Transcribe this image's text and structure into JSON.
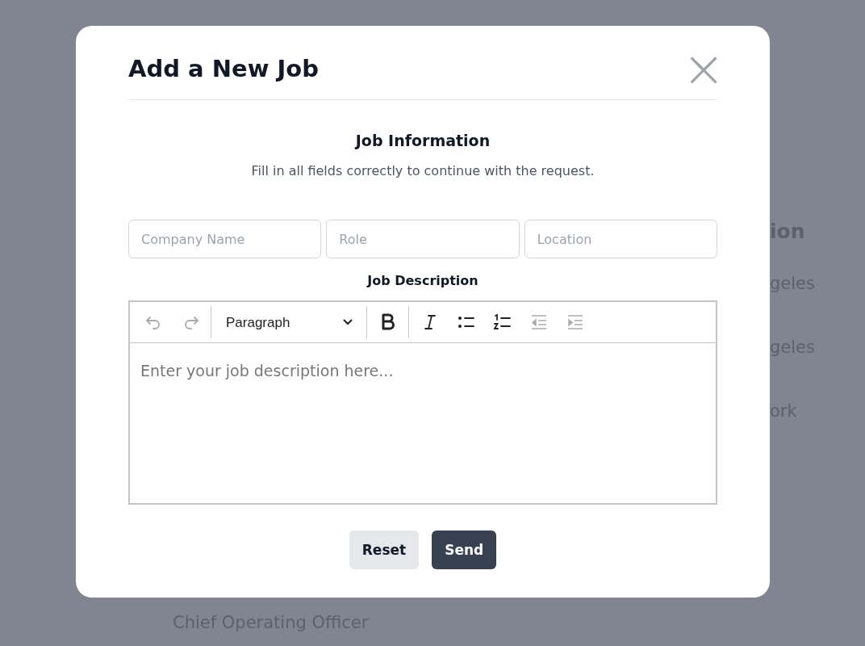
{
  "background": {
    "texts": [
      {
        "text": "ion",
        "kind": "heading"
      },
      {
        "text": "geles",
        "kind": "cell"
      },
      {
        "text": "geles",
        "kind": "cell"
      },
      {
        "text": "ork",
        "kind": "cell"
      }
    ],
    "footer_text": "Chief Operating Officer"
  },
  "modal": {
    "title": "Add a New Job",
    "close": "×",
    "section_title": "Job Information",
    "subtitle": "Fill in all fields correctly to continue with the request.",
    "fields": [
      {
        "placeholder": "Company Name"
      },
      {
        "placeholder": "Role"
      },
      {
        "placeholder": "Location"
      }
    ],
    "description_label": "Job Description",
    "toolbar": {
      "groups": [
        [
          {
            "kind": "undo",
            "disabled": true
          },
          {
            "kind": "redo",
            "disabled": true
          }
        ],
        [
          {
            "kind": "select",
            "value": "Paragraph",
            "disabled": false
          }
        ],
        [
          {
            "kind": "bold",
            "disabled": false
          }
        ],
        [
          {
            "kind": "italic",
            "disabled": false
          },
          {
            "kind": "bullets",
            "disabled": false
          },
          {
            "kind": "numbers",
            "disabled": false
          },
          {
            "kind": "outdent",
            "disabled": true
          },
          {
            "kind": "indent",
            "disabled": true
          }
        ]
      ]
    },
    "editor": {
      "placeholder": "Enter your job description here..."
    },
    "buttons": [
      {
        "label": "Reset",
        "kind": "secondary"
      },
      {
        "label": "Send",
        "kind": "primary"
      }
    ]
  }
}
